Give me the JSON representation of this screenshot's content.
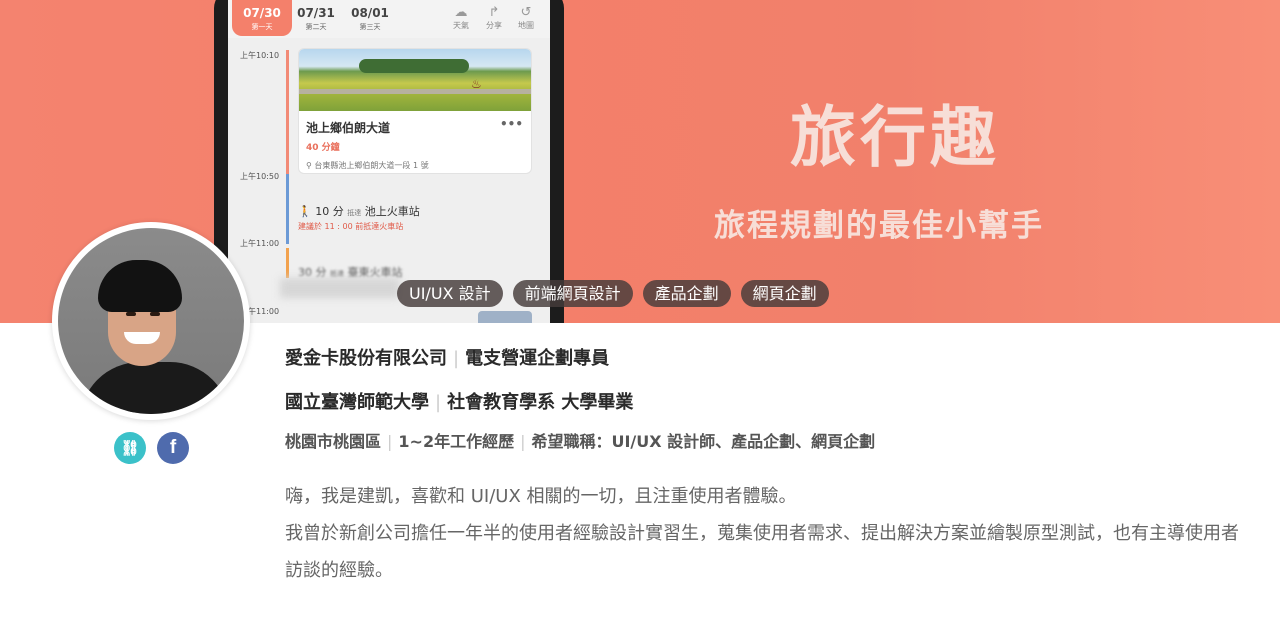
{
  "banner": {
    "title": "旅行趣",
    "subtitle": "旅程規劃的最佳小幫手",
    "colors": {
      "background": "#f4806b",
      "text": "#f7ded7"
    }
  },
  "phone": {
    "dates": [
      {
        "date": "07/30",
        "label": "第一天",
        "active": true
      },
      {
        "date": "07/31",
        "label": "第二天",
        "active": false
      },
      {
        "date": "08/01",
        "label": "第三天",
        "active": false
      }
    ],
    "tools": [
      {
        "icon": "weather-icon",
        "label": "天氣"
      },
      {
        "icon": "share-icon",
        "label": "分享"
      },
      {
        "icon": "map-icon",
        "label": "地圖"
      }
    ],
    "times": [
      "上午10:10",
      "上午10:50",
      "上午11:00",
      "上午11:00"
    ],
    "card": {
      "title": "池上鄉伯朗大道",
      "duration": "40 分鐘",
      "address": "台東縣池上鄉伯朗大道一段 1 號",
      "menu": "•••"
    },
    "transit": {
      "minutes": "10 分",
      "arrive": "抵達",
      "station": "池上火車站",
      "note": "建議於 11 : 00 前抵達火車站"
    },
    "next": {
      "minutes": "30 分",
      "arrive": "抵達",
      "station": "臺東火車站"
    }
  },
  "tags": [
    "UI/UX 設計",
    "前端網頁設計",
    "產品企劃",
    "網頁企劃"
  ],
  "profile": {
    "company": "愛金卡股份有限公司",
    "job_title": "電支營運企劃專員",
    "school": "國立臺灣師範大學",
    "department": "社會教育學系 大學畢業",
    "location": "桃園市桃園區",
    "experience": "1~2年工作經歷",
    "desired": "希望職稱：UI/UX 設計師、產品企劃、網頁企劃",
    "bio": [
      "嗨，我是建凱，喜歡和 UI/UX 相關的一切，且注重使用者體驗。",
      "我曾於新創公司擔任一年半的使用者經驗設計實習生，蒐集使用者需求、提出解決方案並繪製原型測試，也有主導使用者訪談的經驗。"
    ]
  },
  "social": [
    {
      "icon": "link-icon",
      "color": "#3bc1c9"
    },
    {
      "icon": "facebook-icon",
      "color": "#4f6bad"
    }
  ]
}
